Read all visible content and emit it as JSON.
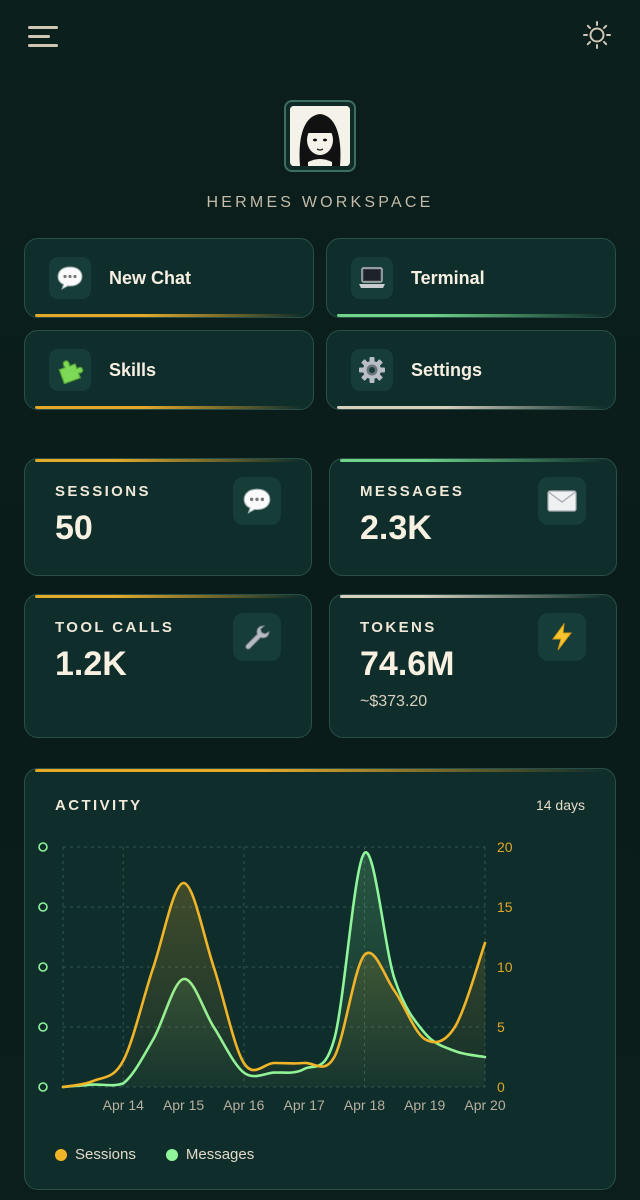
{
  "header": {
    "menu_icon": "hamburger-menu-icon",
    "theme_icon": "sun-icon"
  },
  "workspace": {
    "title": "HERMES WORKSPACE",
    "avatar_icon": "avatar-portrait"
  },
  "actions": [
    {
      "label": "New Chat",
      "icon": "speech-bubble-icon",
      "accent": "#e5a92a"
    },
    {
      "label": "Terminal",
      "icon": "laptop-icon",
      "accent": "#6fd48a"
    },
    {
      "label": "Skills",
      "icon": "puzzle-icon",
      "accent": "#e5a92a"
    },
    {
      "label": "Settings",
      "icon": "gear-icon",
      "accent": "#cfc6b4"
    }
  ],
  "stats": [
    {
      "title": "SESSIONS",
      "value": "50",
      "icon": "speech-bubble-icon",
      "accent": "#e5a92a"
    },
    {
      "title": "MESSAGES",
      "value": "2.3K",
      "icon": "envelope-icon",
      "accent": "#6fd48a"
    },
    {
      "title": "TOOL CALLS",
      "value": "1.2K",
      "icon": "wrench-icon",
      "accent": "#e5a92a"
    },
    {
      "title": "TOKENS",
      "value": "74.6M",
      "sub": "~$373.20",
      "icon": "lightning-icon",
      "accent": "#cfc6b4"
    }
  ],
  "activity": {
    "title": "ACTIVITY",
    "range_label": "14 days",
    "legend": [
      {
        "label": "Sessions",
        "color": "#f0b429"
      },
      {
        "label": "Messages",
        "color": "#8ef59a"
      }
    ]
  },
  "chart_data": {
    "type": "line",
    "categories": [
      "Apr 14",
      "Apr 15",
      "Apr 16",
      "Apr 17",
      "Apr 18",
      "Apr 19",
      "Apr 20"
    ],
    "x": [
      13.0,
      13.5,
      14.0,
      14.5,
      15.0,
      15.5,
      16.0,
      16.5,
      17.0,
      17.5,
      18.0,
      18.5,
      19.0,
      19.5,
      20.0
    ],
    "series": [
      {
        "name": "Sessions",
        "color": "#f0b429",
        "axis": "right",
        "values": [
          0,
          0.5,
          2.2,
          10,
          17,
          10,
          2,
          2,
          2,
          2.5,
          11,
          8,
          4,
          5,
          12
        ]
      },
      {
        "name": "Messages",
        "color": "#8ef59a",
        "axis": "left",
        "values": [
          0,
          0.2,
          0.3,
          4,
          9,
          5,
          1.2,
          1.2,
          1.5,
          4,
          19.5,
          9,
          4.5,
          3,
          2.5
        ]
      }
    ],
    "right_axis": {
      "ticks": [
        "0",
        "5",
        "10",
        "15",
        "20"
      ],
      "ylim": [
        0,
        20
      ]
    },
    "left_axis": {
      "ylim": [
        0,
        20
      ]
    },
    "grid": true,
    "legend_position": "bottom-left"
  }
}
